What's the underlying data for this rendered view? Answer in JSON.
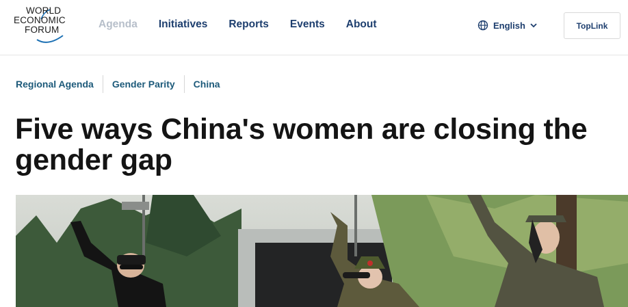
{
  "header": {
    "logo": {
      "lines": [
        "WORLD",
        "ECONOMIC",
        "FORUM"
      ]
    },
    "nav": [
      {
        "label": "Agenda",
        "active": true
      },
      {
        "label": "Initiatives"
      },
      {
        "label": "Reports"
      },
      {
        "label": "Events"
      },
      {
        "label": "About"
      }
    ],
    "language": {
      "label": "English",
      "icon": "globe-icon"
    },
    "toplink_label": "TopLink"
  },
  "breadcrumb": {
    "tags": [
      "Regional Agenda",
      "Gender Parity",
      "China"
    ]
  },
  "article": {
    "title": "Five ways China's women are closing the gender gap"
  },
  "colors": {
    "nav_text": "#1d3e6e",
    "nav_active": "#b7bfca",
    "tag_text": "#1d5a7a",
    "title_text": "#141414"
  }
}
